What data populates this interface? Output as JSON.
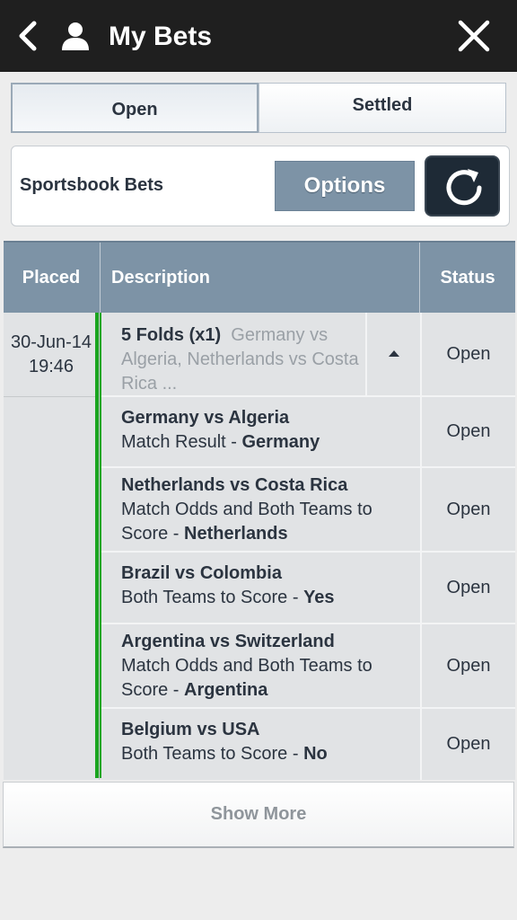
{
  "header": {
    "title": "My Bets",
    "back_icon": "back-chevron-icon",
    "user_icon": "user-icon",
    "close_icon": "close-icon"
  },
  "tabs": [
    {
      "label": "Open",
      "active": true
    },
    {
      "label": "Settled",
      "active": false
    }
  ],
  "sportsbook": {
    "title": "Sportsbook Bets",
    "options_label": "Options",
    "refresh_icon": "refresh-icon"
  },
  "table": {
    "headers": {
      "placed": "Placed",
      "description": "Description",
      "status": "Status"
    },
    "bet": {
      "placed_date": "30-Jun-14",
      "placed_time": "19:46",
      "summary_title": "5 Folds (x1)",
      "summary_detail": "Germany vs Algeria, Netherlands vs Costa Rica ...",
      "status": "Open"
    },
    "selections": [
      {
        "match": "Germany vs Algeria",
        "market": "Match Result - ",
        "pick": "Germany",
        "status": "Open"
      },
      {
        "match": "Netherlands vs Costa Rica",
        "market": "Match Odds and Both Teams to Score - ",
        "pick": "Netherlands",
        "status": "Open"
      },
      {
        "match": "Brazil vs Colombia",
        "market": "Both Teams to Score - ",
        "pick": "Yes",
        "status": "Open"
      },
      {
        "match": "Argentina vs Switzerland",
        "market": "Match Odds and Both Teams to Score - ",
        "pick": "Argentina",
        "status": "Open"
      },
      {
        "match": "Belgium vs USA",
        "market": "Both Teams to Score - ",
        "pick": "No",
        "status": "Open"
      }
    ]
  },
  "show_more_label": "Show More",
  "colors": {
    "header_bg": "#1f1f1f",
    "table_header_bg": "#7d93a6",
    "accent_green": "#1aa51f"
  }
}
